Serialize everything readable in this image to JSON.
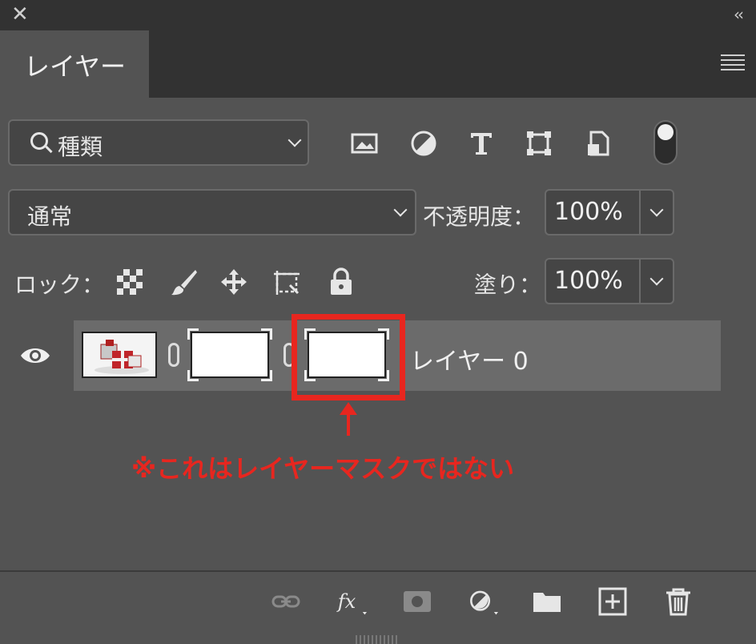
{
  "window": {
    "close_glyph": "✕",
    "collapse_glyph": "‹‹"
  },
  "tab": {
    "label": "レイヤー"
  },
  "filter": {
    "selected": "種類",
    "icons": [
      "image-filter-icon",
      "adjustment-filter-icon",
      "type-filter-icon",
      "shape-filter-icon",
      "smart-object-filter-icon"
    ]
  },
  "blend": {
    "selected": "通常"
  },
  "opacity": {
    "label": "不透明度：",
    "value": "100%"
  },
  "lock": {
    "label": "ロック："
  },
  "fill": {
    "label": "塗り：",
    "value": "100%"
  },
  "layer": {
    "name": "レイヤー 0"
  },
  "annotation": {
    "text": "※これはレイヤーマスクではない"
  },
  "colors": {
    "highlight": "#e8261f",
    "panel": "#535353",
    "selected_row": "#6b6b6b"
  }
}
